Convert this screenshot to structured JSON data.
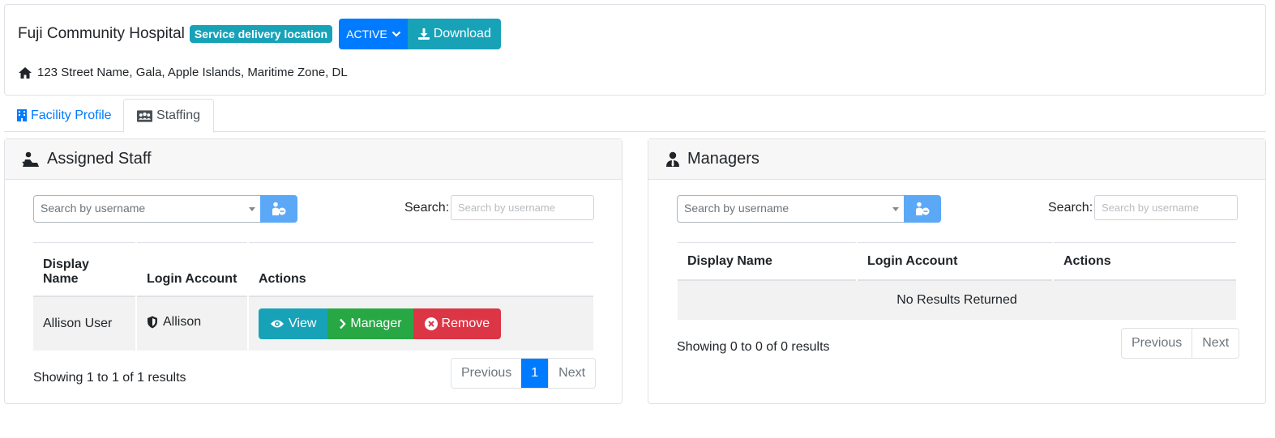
{
  "facility": {
    "name": "Fuji Community Hospital",
    "badge": "Service delivery location",
    "status": "ACTIVE",
    "download_label": "Download",
    "address": "123 Street Name, Gala, Apple Islands, Maritime Zone, DL"
  },
  "tabs": [
    {
      "label": "Facility Profile",
      "icon": "hospital-icon",
      "active": false
    },
    {
      "label": "Staffing",
      "icon": "users-icon",
      "active": true
    }
  ],
  "assigned_staff": {
    "title": "Assigned Staff",
    "select_placeholder": "Search by username",
    "search_label": "Search:",
    "search_placeholder": "Search by username",
    "columns": [
      "Display Name",
      "Login Account",
      "Actions"
    ],
    "rows": [
      {
        "display_name": "Allison User",
        "login_account": "Allison"
      }
    ],
    "actions": {
      "view": "View",
      "manager": "Manager",
      "remove": "Remove"
    },
    "showing": "Showing 1 to 1 of 1 results",
    "pagination": {
      "previous": "Previous",
      "page": "1",
      "next": "Next"
    }
  },
  "managers": {
    "title": "Managers",
    "select_placeholder": "Search by username",
    "search_label": "Search:",
    "search_placeholder": "Search by username",
    "columns": [
      "Display Name",
      "Login Account",
      "Actions"
    ],
    "empty": "No Results Returned",
    "showing": "Showing 0 to 0 of 0 results",
    "pagination": {
      "previous": "Previous",
      "next": "Next"
    }
  },
  "colors": {
    "primary": "#007bff",
    "info": "#17a2b8",
    "success": "#28a745",
    "danger": "#dc3545"
  }
}
